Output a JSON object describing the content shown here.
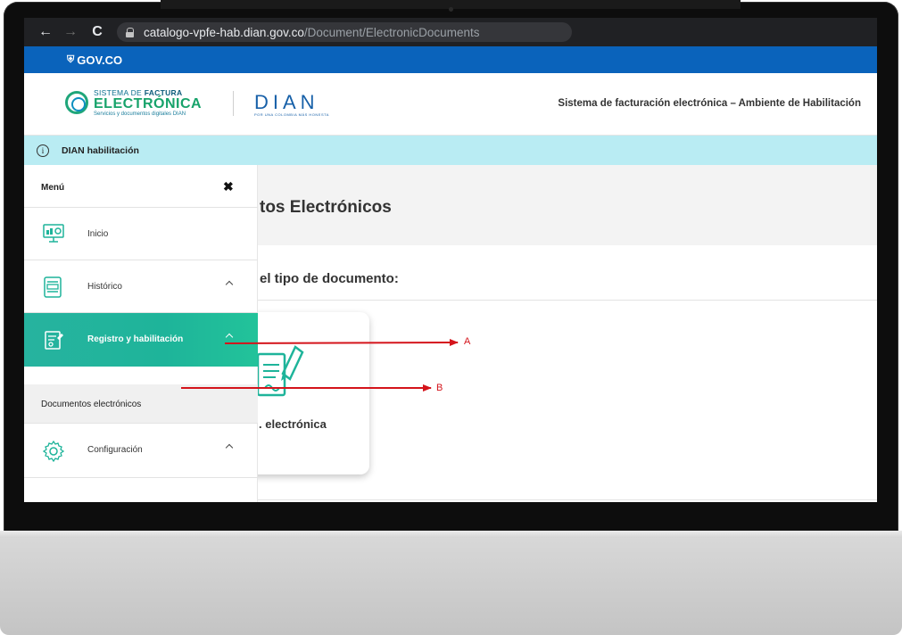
{
  "browser": {
    "back": "←",
    "forward": "→",
    "reload": "C",
    "url_host": "catalogo-vpfe-hab.dian.gov.co",
    "url_path": "/Document/ElectronicDocuments"
  },
  "govbar": {
    "label": "GOV.CO"
  },
  "header": {
    "sfe_line1": "SISTEMA DE",
    "sfe_line1_bold": "FACTURA",
    "sfe_line2": "ELECTRÓNICA",
    "sfe_line3": "Servicios y documentos digitales DIAN",
    "dian": "DIAN",
    "dian_sub": "POR UNA COLOMBIA MÁS HONESTA",
    "title": "Sistema de facturación electrónica – Ambiente de Habilitación"
  },
  "infobar": {
    "icon": "i",
    "text": "DIAN habilitación"
  },
  "main": {
    "title": "tos Electrónicos",
    "subtitle": "el tipo de documento:",
    "card_label": ". electrónica"
  },
  "sidebar": {
    "title": "Menú",
    "close": "✖",
    "items": [
      {
        "label": "Inicio",
        "icon": "dashboard-icon"
      },
      {
        "label": "Histórico",
        "icon": "document-list-icon"
      },
      {
        "label": "Registro y habilitación",
        "icon": "registration-icon"
      },
      {
        "label": "Configuración",
        "icon": "gear-icon"
      }
    ],
    "sub_items": [
      {
        "label": "Documentos electrónicos"
      }
    ]
  },
  "annotations": {
    "a": "A",
    "b": "B",
    "color": "#d4141b"
  },
  "colors": {
    "govbar": "#0a63bb",
    "infobar": "#b9ecf3",
    "active": "#1eb49a"
  }
}
